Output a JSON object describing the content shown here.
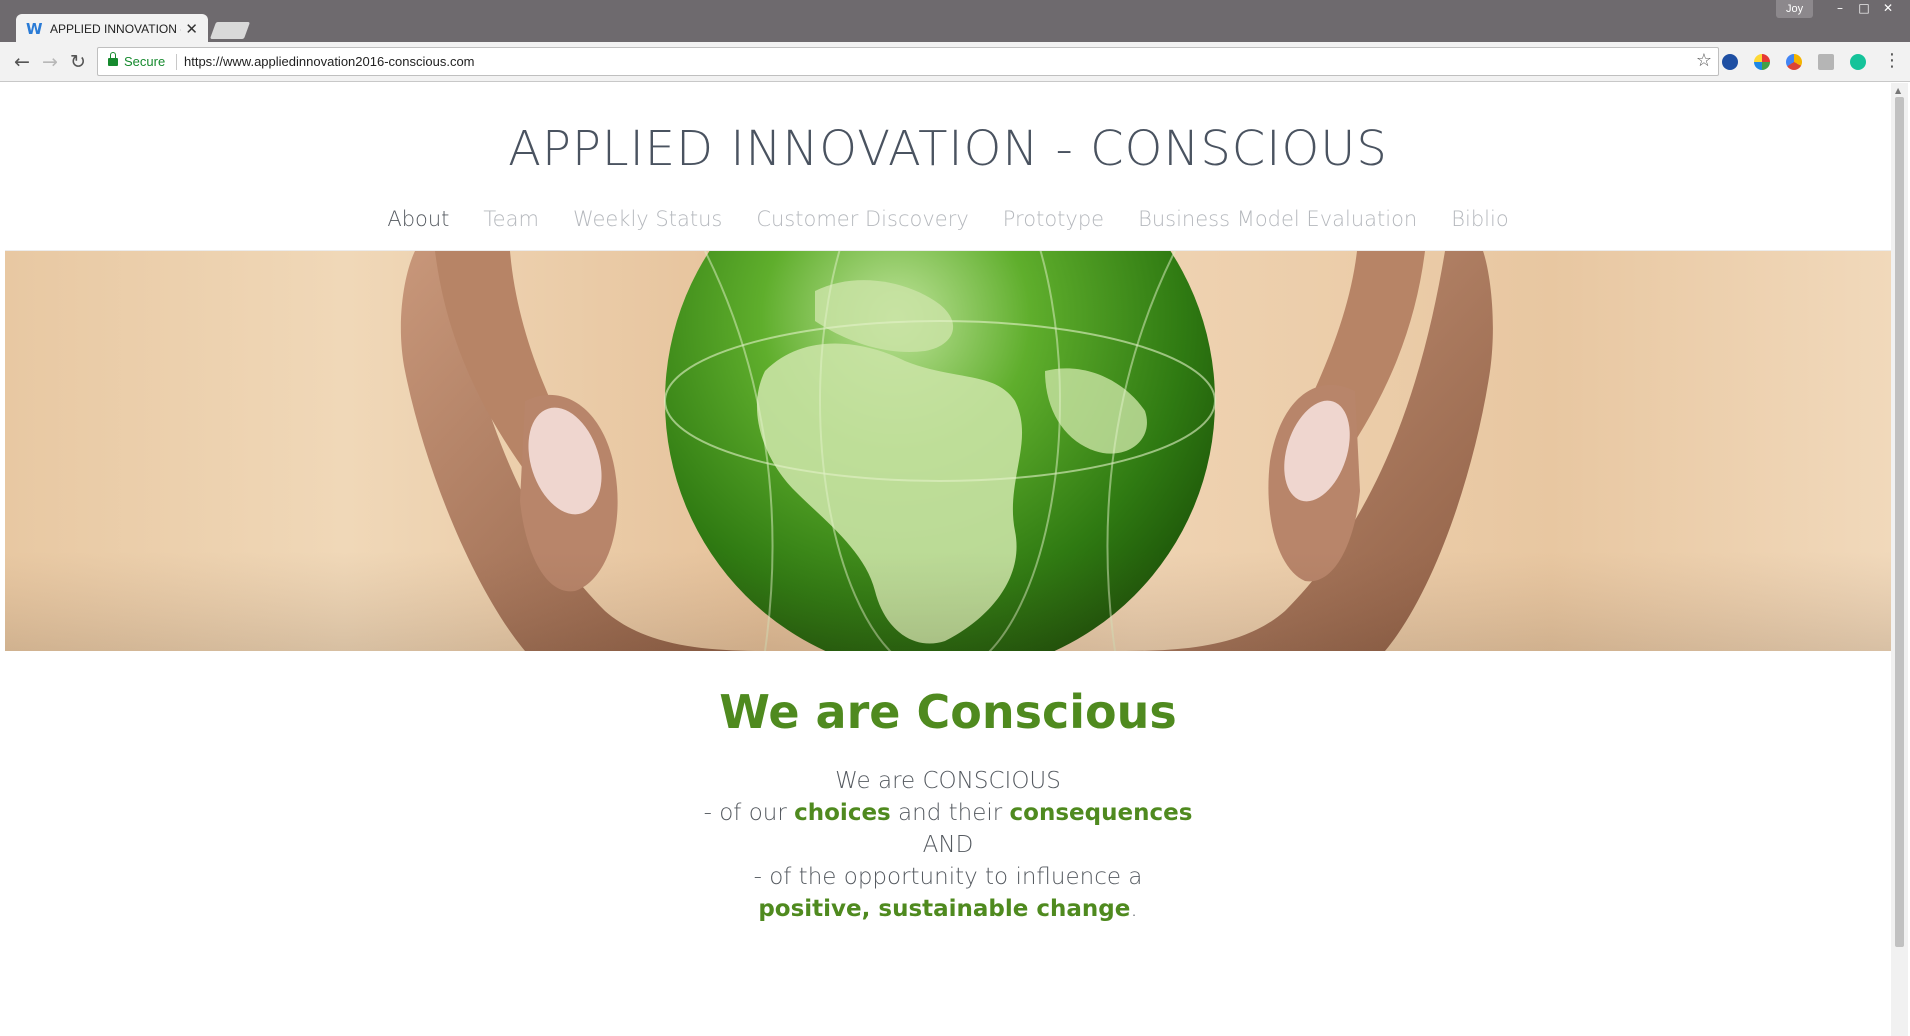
{
  "browser": {
    "tab_title": "APPLIED INNOVATION - C",
    "tab_close": "✕",
    "profile_name": "Joy",
    "secure_label": "Secure",
    "url": "https://www.appliedinnovation2016-conscious.com"
  },
  "site": {
    "title": "APPLIED INNOVATION - CONSCIOUS",
    "nav": [
      {
        "label": "About",
        "active": true
      },
      {
        "label": "Team",
        "active": false
      },
      {
        "label": "Weekly Status",
        "active": false
      },
      {
        "label": "Customer Discovery",
        "active": false
      },
      {
        "label": "Prototype",
        "active": false
      },
      {
        "label": "Business Model Evaluation",
        "active": false
      },
      {
        "label": "Biblio",
        "active": false
      }
    ],
    "hero_image": "hands-holding-green-glass-globe",
    "headline": "We are Conscious",
    "body": {
      "line1": "We are CONSCIOUS",
      "line2_pre": "- of our ",
      "line2_b1": "choices",
      "line2_mid": " and their ",
      "line2_b2": "consequences",
      "line3": "AND",
      "line4": "- of the opportunity to influence a",
      "line5_b": "positive, sustainable change",
      "line5_post": "."
    }
  },
  "colors": {
    "accent_green": "#4f8a1f",
    "nav_active": "#555a60",
    "nav_inactive": "#b5b8bd",
    "secure_green": "#168a2e"
  }
}
